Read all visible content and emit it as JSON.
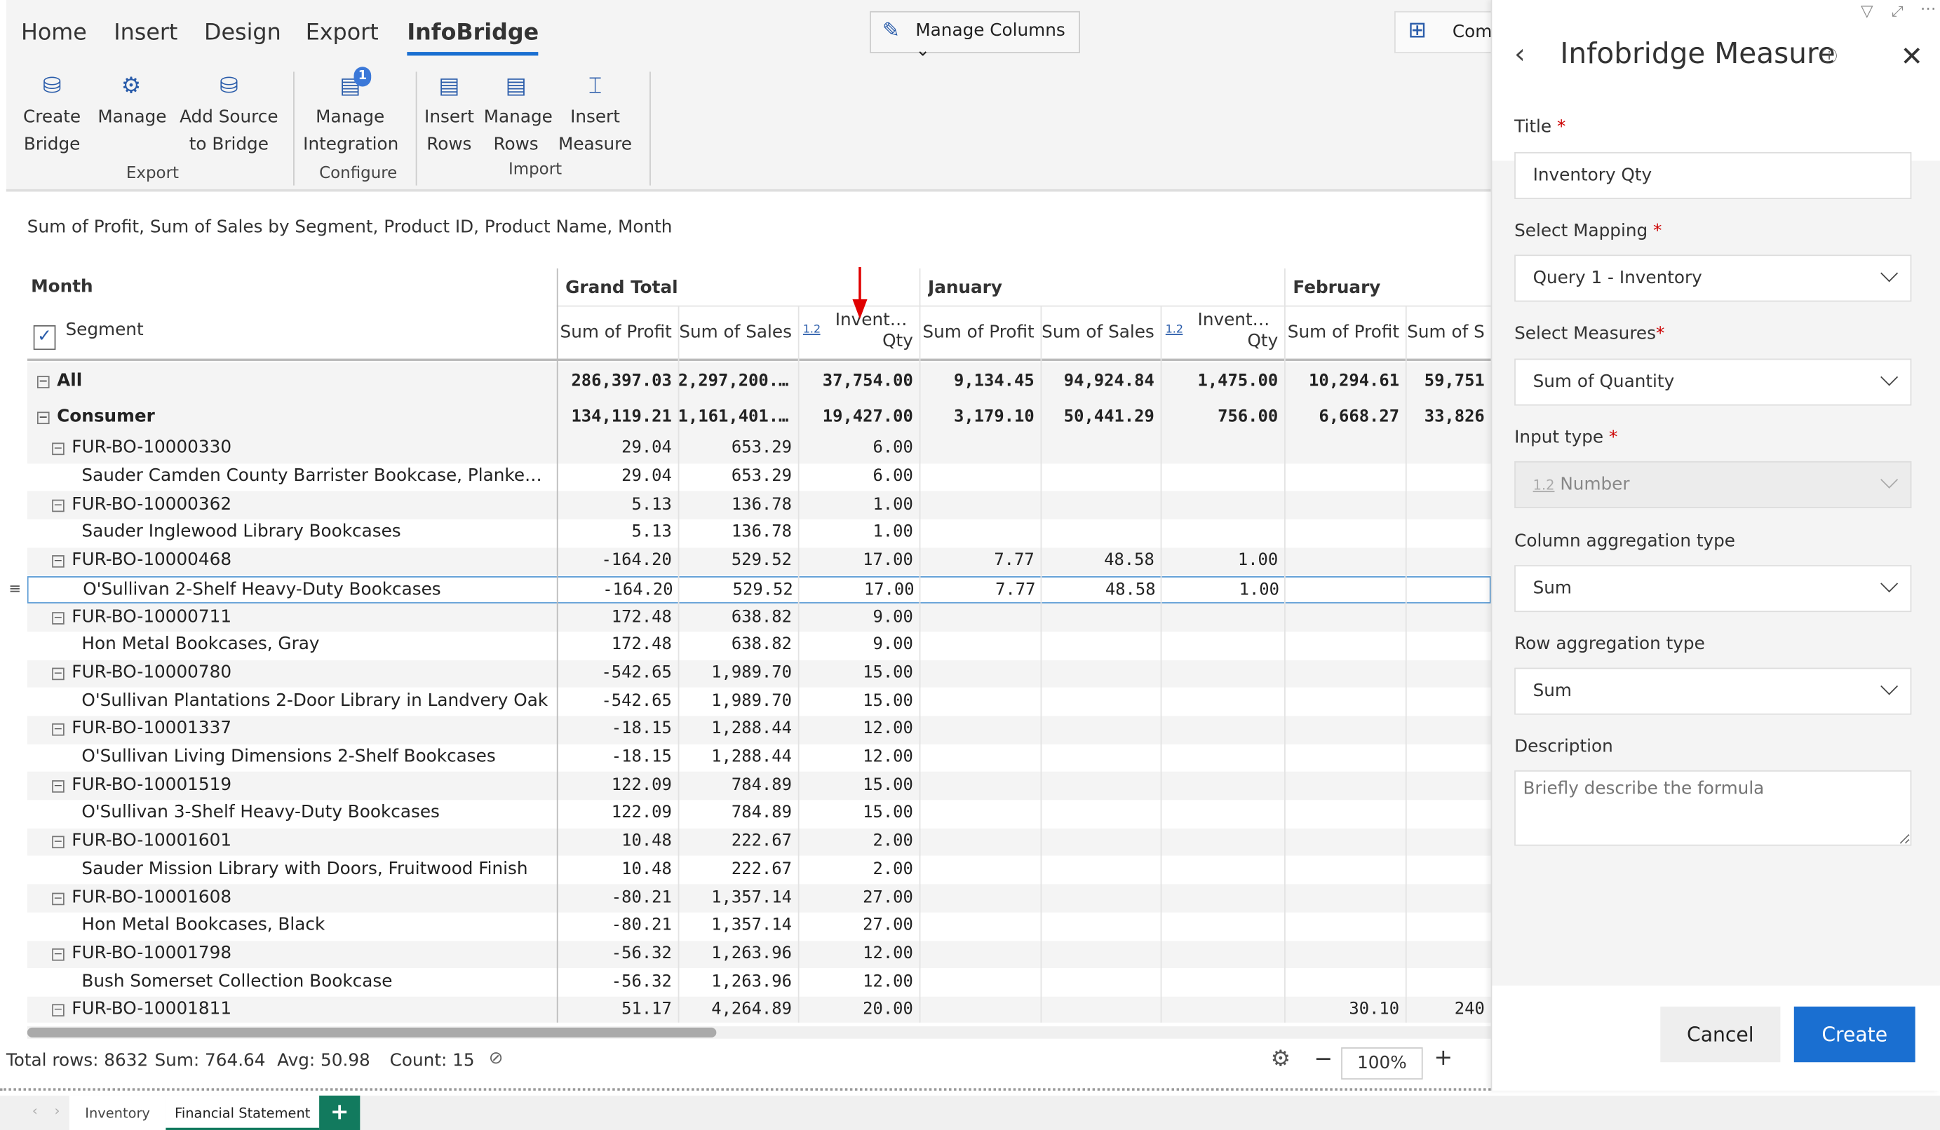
{
  "ribbon": {
    "tabs": [
      "Home",
      "Insert",
      "Design",
      "Export",
      "InfoBridge"
    ],
    "active_tab": "InfoBridge",
    "buttons": [
      {
        "l1": "Create",
        "l2": "Bridge"
      },
      {
        "l1": "Manage",
        "l2": ""
      },
      {
        "l1": "Add Source",
        "l2": "to Bridge"
      },
      {
        "l1": "Manage",
        "l2": "Integration",
        "badge": "1"
      },
      {
        "l1": "Insert",
        "l2": "Rows"
      },
      {
        "l1": "Manage",
        "l2": "Rows"
      },
      {
        "l1": "Insert",
        "l2": "Measure"
      }
    ],
    "groups": [
      "Export",
      "Configure",
      "Import"
    ],
    "manage_columns": "Manage Columns",
    "comments": "Comments"
  },
  "caption": "Sum of Profit, Sum of Sales by Segment, Product ID, Product Name, Month",
  "grid": {
    "row_header": "Month",
    "segment_header": "Segment",
    "months": [
      "Grand Total",
      "January",
      "February"
    ],
    "columns": [
      "Sum of Profit",
      "Sum of Sales",
      "Inventory Qty",
      "Sum of Profit",
      "Sum of Sales",
      "Inventory Qty",
      "Sum of Profit",
      "Sum of S"
    ],
    "number_badge": "1.2",
    "rows": [
      {
        "label": "All",
        "level": 0,
        "bold": true,
        "box": true,
        "v": [
          "286,397.03",
          "2,297,200...",
          "37,754.00",
          "9,134.45",
          "94,924.84",
          "1,475.00",
          "10,294.61",
          "59,751"
        ]
      },
      {
        "label": "Consumer",
        "level": 0,
        "bold": true,
        "box": true,
        "v": [
          "134,119.21",
          "1,161,401...",
          "19,427.00",
          "3,179.10",
          "50,441.29",
          "756.00",
          "6,668.27",
          "33,826"
        ]
      },
      {
        "label": "FUR-BO-10000330",
        "level": 1,
        "box": true,
        "v": [
          "29.04",
          "653.29",
          "6.00"
        ]
      },
      {
        "label": "Sauder Camden County Barrister Bookcase, Planked Cher...",
        "level": 2,
        "v": [
          "29.04",
          "653.29",
          "6.00"
        ]
      },
      {
        "label": "FUR-BO-10000362",
        "level": 1,
        "box": true,
        "v": [
          "5.13",
          "136.78",
          "1.00"
        ]
      },
      {
        "label": "Sauder Inglewood Library Bookcases",
        "level": 2,
        "v": [
          "5.13",
          "136.78",
          "1.00"
        ]
      },
      {
        "label": "FUR-BO-10000468",
        "level": 1,
        "box": true,
        "v": [
          "-164.20",
          "529.52",
          "17.00",
          "7.77",
          "48.58",
          "1.00"
        ]
      },
      {
        "label": "O'Sullivan 2-Shelf Heavy-Duty Bookcases",
        "level": 2,
        "selected": true,
        "v": [
          "-164.20",
          "529.52",
          "17.00",
          "7.77",
          "48.58",
          "1.00"
        ]
      },
      {
        "label": "FUR-BO-10000711",
        "level": 1,
        "box": true,
        "v": [
          "172.48",
          "638.82",
          "9.00"
        ]
      },
      {
        "label": "Hon Metal Bookcases, Gray",
        "level": 2,
        "v": [
          "172.48",
          "638.82",
          "9.00"
        ]
      },
      {
        "label": "FUR-BO-10000780",
        "level": 1,
        "box": true,
        "v": [
          "-542.65",
          "1,989.70",
          "15.00"
        ]
      },
      {
        "label": "O'Sullivan Plantations 2-Door Library in Landvery Oak",
        "level": 2,
        "v": [
          "-542.65",
          "1,989.70",
          "15.00"
        ]
      },
      {
        "label": "FUR-BO-10001337",
        "level": 1,
        "box": true,
        "v": [
          "-18.15",
          "1,288.44",
          "12.00"
        ]
      },
      {
        "label": "O'Sullivan Living Dimensions 2-Shelf Bookcases",
        "level": 2,
        "v": [
          "-18.15",
          "1,288.44",
          "12.00"
        ]
      },
      {
        "label": "FUR-BO-10001519",
        "level": 1,
        "box": true,
        "v": [
          "122.09",
          "784.89",
          "15.00"
        ]
      },
      {
        "label": "O'Sullivan 3-Shelf Heavy-Duty Bookcases",
        "level": 2,
        "v": [
          "122.09",
          "784.89",
          "15.00"
        ]
      },
      {
        "label": "FUR-BO-10001601",
        "level": 1,
        "box": true,
        "v": [
          "10.48",
          "222.67",
          "2.00"
        ]
      },
      {
        "label": "Sauder Mission Library with Doors, Fruitwood Finish",
        "level": 2,
        "v": [
          "10.48",
          "222.67",
          "2.00"
        ]
      },
      {
        "label": "FUR-BO-10001608",
        "level": 1,
        "box": true,
        "v": [
          "-80.21",
          "1,357.14",
          "27.00"
        ]
      },
      {
        "label": "Hon Metal Bookcases, Black",
        "level": 2,
        "v": [
          "-80.21",
          "1,357.14",
          "27.00"
        ]
      },
      {
        "label": "FUR-BO-10001798",
        "level": 1,
        "box": true,
        "v": [
          "-56.32",
          "1,263.96",
          "12.00"
        ]
      },
      {
        "label": "Bush Somerset Collection Bookcase",
        "level": 2,
        "v": [
          "-56.32",
          "1,263.96",
          "12.00"
        ]
      },
      {
        "label": "FUR-BO-10001811",
        "level": 1,
        "box": true,
        "v": [
          "51.17",
          "4,264.89",
          "20.00",
          "",
          "",
          "",
          "30.10",
          "240"
        ]
      }
    ]
  },
  "status": {
    "total_rows": "Total rows: 8632",
    "sum": "Sum: 764.64",
    "avg": "Avg: 50.98",
    "count": "Count: 15",
    "zoom": "100%"
  },
  "sheets": [
    "Inventory",
    "Financial Statement"
  ],
  "panel": {
    "title": "Infobridge Measure",
    "title_label": "Title",
    "title_value": "Inventory Qty",
    "mapping_label": "Select Mapping",
    "mapping_value": "Query 1 - Inventory",
    "measures_label": "Select Measures",
    "measures_value": "Sum of Quantity",
    "input_type_label": "Input type",
    "input_type_badge": "1.2",
    "input_type_value": "Number",
    "col_agg_label": "Column aggregation type",
    "col_agg_value": "Sum",
    "row_agg_label": "Row aggregation type",
    "row_agg_value": "Sum",
    "description_label": "Description",
    "description_placeholder": "Briefly describe the formula",
    "cancel": "Cancel",
    "create": "Create"
  },
  "colors": {
    "accent": "#1a6fd1",
    "arrow": "#e00000",
    "sheet_add": "#127a5e"
  }
}
